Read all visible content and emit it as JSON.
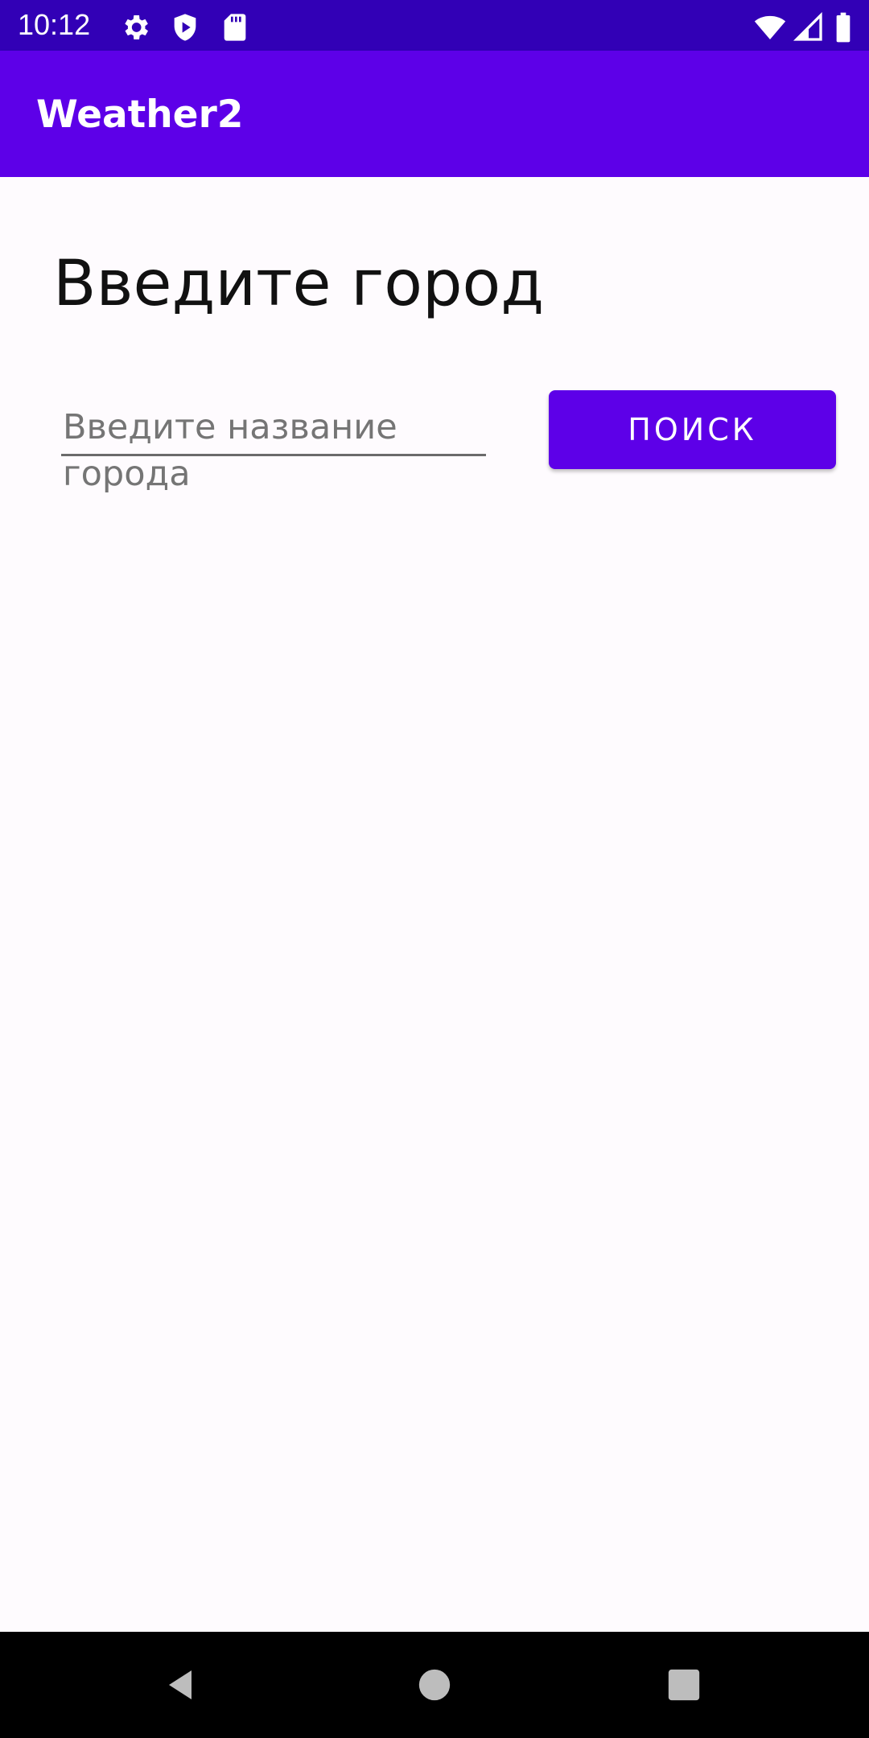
{
  "status_bar": {
    "time": "10:12",
    "icons": [
      "gear-icon",
      "shield-play-icon",
      "sd-card-icon",
      "wifi-icon",
      "signal-icon",
      "battery-icon"
    ]
  },
  "app_bar": {
    "title": "Weather2"
  },
  "main": {
    "heading": "Введите город",
    "city_input": {
      "value": "",
      "placeholder": "Введите название города"
    },
    "search_button_label": "ПОИСК"
  },
  "nav_bar": {
    "icons": [
      "back-icon",
      "home-icon",
      "recents-icon"
    ]
  },
  "colors": {
    "status_bar": "#3200b6",
    "app_bar": "#5d00e8",
    "accent": "#5d00e8",
    "background": "#fefbfe",
    "nav_bar": "#000000"
  }
}
